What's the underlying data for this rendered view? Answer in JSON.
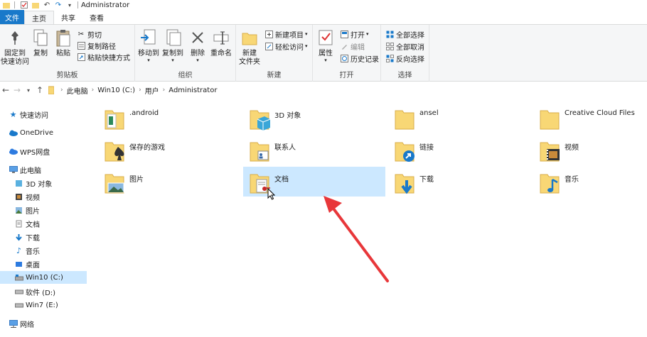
{
  "titlebar": {
    "title": "Administrator"
  },
  "tabs": [
    "文件",
    "主页",
    "共享",
    "查看"
  ],
  "ribbon": {
    "clipboard": {
      "label": "剪贴板",
      "pin_quick_access": "固定到\n快速访问",
      "copy": "复制",
      "paste": "粘贴",
      "cut": "剪切",
      "copy_path": "复制路径",
      "paste_shortcut": "粘贴快捷方式"
    },
    "organize": {
      "label": "组织",
      "move_to": "移动到",
      "copy_to": "复制到",
      "delete": "删除",
      "rename": "重命名"
    },
    "new": {
      "label": "新建",
      "new_folder": "新建\n文件夹",
      "new_item": "新建项目",
      "easy_access": "轻松访问"
    },
    "open": {
      "label": "打开",
      "properties": "属性",
      "open": "打开",
      "edit": "编辑",
      "history": "历史记录"
    },
    "select": {
      "label": "选择",
      "select_all": "全部选择",
      "select_none": "全部取消",
      "invert": "反向选择"
    }
  },
  "address": {
    "crumbs": [
      "此电脑",
      "Win10 (C:)",
      "用户",
      "Administrator"
    ]
  },
  "navpane": {
    "quick_access": "快速访问",
    "onedrive": "OneDrive",
    "wps": "WPS网盘",
    "this_pc": "此电脑",
    "items": [
      "3D 对象",
      "视频",
      "图片",
      "文档",
      "下载",
      "音乐",
      "桌面",
      "Win10 (C:)",
      "软件 (D:)",
      "Win7 (E:)"
    ],
    "network": "网络"
  },
  "files": [
    {
      "name": ".android"
    },
    {
      "name": "3D 对象"
    },
    {
      "name": "ansel"
    },
    {
      "name": "Creative Cloud Files"
    },
    {
      "name": "保存的游戏"
    },
    {
      "name": "联系人"
    },
    {
      "name": "链接"
    },
    {
      "name": "视频"
    },
    {
      "name": "图片"
    },
    {
      "name": "文档"
    },
    {
      "name": "下载"
    },
    {
      "name": "音乐"
    }
  ],
  "colors": {
    "accent": "#1979ca",
    "selection": "#cce8ff",
    "folder": "#f8d775",
    "arrow": "#e8373a"
  }
}
